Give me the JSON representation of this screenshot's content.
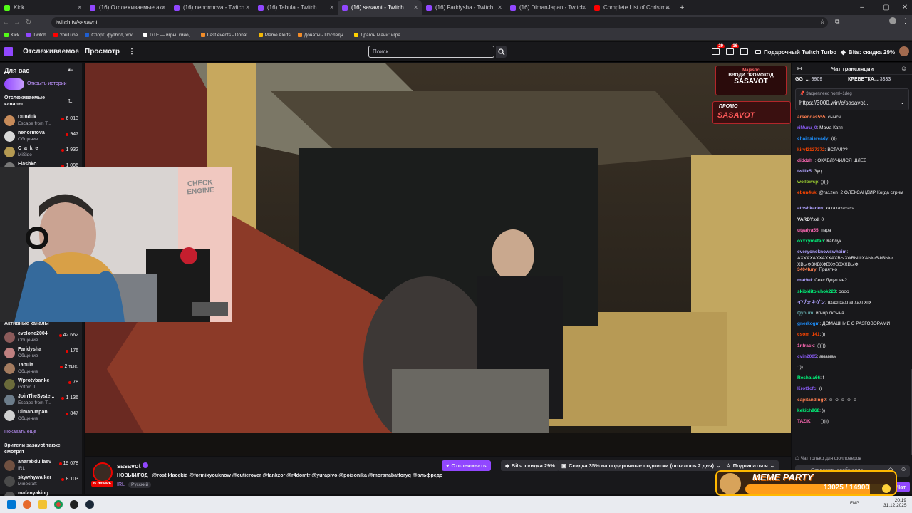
{
  "browser": {
    "tabs": [
      {
        "label": "Kick",
        "color": "#53fc18",
        "active": false
      },
      {
        "label": "(16) Отслеживаемые активные",
        "color": "#9147ff",
        "active": false
      },
      {
        "label": "(16) nenormova - Twitch",
        "color": "#9147ff",
        "active": false
      },
      {
        "label": "(16) Tabula - Twitch",
        "color": "#9147ff",
        "active": false
      },
      {
        "label": "(16) sasavot - Twitch",
        "color": "#9147ff",
        "active": true
      },
      {
        "label": "(16) Faridysha - Twitch",
        "color": "#9147ff",
        "active": false
      },
      {
        "label": "(16) DimanJapan - Twitch",
        "color": "#9147ff",
        "active": false
      },
      {
        "label": "Complete List of Christmas",
        "color": "#ff0000",
        "active": false
      }
    ],
    "url": "twitch.tv/sasavot",
    "bookmarks": [
      {
        "label": "Kick",
        "color": "#53fc18"
      },
      {
        "label": "Twitch",
        "color": "#9147ff"
      },
      {
        "label": "YouTube",
        "color": "#ff0000"
      },
      {
        "label": "Спорт: футбол, хок...",
        "color": "#1f5fd1"
      },
      {
        "label": "DTF — игры, кино,...",
        "color": "#ffffff"
      },
      {
        "label": "Last events - Donat...",
        "color": "#f28c28"
      },
      {
        "label": "Meme Alerts",
        "color": "#f2b705"
      },
      {
        "label": "Донаты - Последн...",
        "color": "#f28c28"
      },
      {
        "label": "Драгон Мани: игра...",
        "color": "#ffd200"
      }
    ]
  },
  "twitch": {
    "nav": {
      "following": "Отслеживаемое",
      "browse": "Просмотр",
      "more": "⋮"
    },
    "search_placeholder": "Поиск",
    "notif_count_1": "29",
    "notif_count_2": "16",
    "gift_turbo": "Подарочный Twitch Turbo",
    "bits_sale": "Bits: скидка 29%"
  },
  "sidebar": {
    "for_you": "Для вас",
    "open_stories": "Открыть истории",
    "followed_title": "Отслеживаемые каналы",
    "followed": [
      {
        "name": "Dunduk",
        "game": "Escape from T...",
        "viewers": "6 013",
        "color": "#c78b5a"
      },
      {
        "name": "nenormova",
        "game": "Общение",
        "viewers": "947",
        "color": "#d8d8d8"
      },
      {
        "name": "C_a_k_e",
        "game": "MiSide",
        "viewers": "1 932",
        "color": "#b59a52"
      },
      {
        "name": "Flashko",
        "game": "",
        "viewers": "1 096",
        "color": "#777"
      }
    ],
    "active_title": "Активные каналы",
    "active": [
      {
        "name": "evelone2004",
        "game": "Общение",
        "viewers": "42 662",
        "color": "#8b5a5a"
      },
      {
        "name": "Faridysha",
        "game": "Общение",
        "viewers": "176",
        "color": "#c08080"
      },
      {
        "name": "Tabula",
        "game": "Общение",
        "viewers": "2 тыс.",
        "color": "#a47b5f"
      },
      {
        "name": "Wprotvbanke",
        "game": "Gothic II",
        "viewers": "78",
        "color": "#6b6b3a"
      },
      {
        "name": "JoinTheSyste...",
        "game": "Escape from T...",
        "viewers": "1 136",
        "color": "#6c7c8a"
      },
      {
        "name": "DimanJapan",
        "game": "Общение",
        "viewers": "847",
        "color": "#d0d0d0"
      }
    ],
    "show_more": "Показать еще",
    "also_watch_title": "Зрители sasavot также смотрят",
    "also_watch": [
      {
        "name": "anarabdullaev",
        "game": "IRL",
        "viewers": "19 078",
        "color": "#705040"
      },
      {
        "name": "skywhywalker",
        "game": "Minecraft",
        "viewers": "8 103",
        "color": "#4a4a4a"
      },
      {
        "name": "mafanyaking",
        "game": "",
        "viewers": "",
        "color": "#555"
      }
    ]
  },
  "video_overlay": {
    "promo_brand": "Majestic",
    "promo_line": "ВВОДИ ПРОМОКОД",
    "promo_code": "SASAVOT",
    "promo2_top": "ПРОМО",
    "promo2_code": "SASAVOT"
  },
  "webcam": {
    "sign_line1": "CHECK",
    "sign_line2": "ENGINE"
  },
  "stream_info": {
    "channel": "sasavot",
    "title": "НОВЫЙ/ГОД | @rostikfacekid @formixyouknow @cutierover @tankzor @r4domtr @yurapivo @poisonika @moranabattoryq @альфредо",
    "live_badge": "В ЭФИРЕ",
    "category": "IRL",
    "language": "Русский",
    "follow_btn": "Отслеживать",
    "bits_btn": "Bits: скидка 29%",
    "gift_sale": "Скидка 35% на подарочные подписки (осталось 2 дня)",
    "subscribe_btn": "Подписаться"
  },
  "meme_party": {
    "title": "MEME PARTY",
    "progress_text": "13025 / 14900",
    "progress": 0.874
  },
  "chat": {
    "header": "Чат трансляции",
    "top_gifters": [
      {
        "name": "GG_...",
        "count": "6909"
      },
      {
        "name": "КРЕВЕТКА...",
        "count": "3333"
      }
    ],
    "pinned_by": "Закреплено",
    "pinned_user": "homl=1deg",
    "pinned_link": "https://3000.win/c/sasavot...",
    "messages": [
      {
        "user": "arsendas555",
        "color": "#ff7f50",
        "text": "сычсч"
      },
      {
        "user": "riMuru_0",
        "color": "#8a5cf5",
        "text": "Мама Катя"
      },
      {
        "user": "chainsisready",
        "color": "#1e90ff",
        "text": "))))"
      },
      {
        "user": "kirvl2137372",
        "color": "#ff4500",
        "text": "ВСТАЛ??"
      },
      {
        "user": "diddzh_",
        "color": "#ff69b4",
        "text": "ОКАБЛУЧИЛСЯ ШЛЕБ"
      },
      {
        "user": "twiiix5",
        "color": "#b0a3ff",
        "text": "Зуц"
      },
      {
        "user": "wollowsp",
        "color": "#9acd32",
        "text": ")))))"
      },
      {
        "user": "ebun4uk",
        "color": "#ff4500",
        "text": "@ra1zen_2 ОЛЕКСАНДИР Когда стрим"
      },
      {
        "user": "atbshkaden",
        "color": "#b0a3ff",
        "text": "хахахахахаха"
      },
      {
        "user": "VARDYxd",
        "color": "#efeff1",
        "text": "0"
      },
      {
        "user": "utyalya55",
        "color": "#ff69b4",
        "text": "пара"
      },
      {
        "user": "oxxxymetan",
        "color": "#00ff7f",
        "text": "Каблук"
      },
      {
        "user": "everyoneknowswhoim",
        "color": "#b0a3ff",
        "text": "АХХАХАХХАХХАХВЫХФВЫФХАЫФВФВЫФ ХВЫФЗХВХФВХФВЗХХВЫФ"
      },
      {
        "user": "3404fury",
        "color": "#ff7f50",
        "text": "Приятно"
      },
      {
        "user": "mat9ei",
        "color": "#b0a3ff",
        "text": "Секс будет не?"
      },
      {
        "user": "skibiditolchok220",
        "color": "#00ff7f",
        "text": "оооо"
      },
      {
        "user": "イヴォキゲン",
        "color": "#b0a3ff",
        "text": "пхахпхахпапхахпхпх"
      },
      {
        "user": "Qyoum",
        "color": "#5f9ea0",
        "text": "игнор сксыча"
      },
      {
        "user": "gnerkogm",
        "color": "#1e90ff",
        "text": "ДОМАШНИЕ С РАЗГОВОРАМИ"
      },
      {
        "user": "csom_141",
        "color": "#ff4500",
        "text": "))"
      },
      {
        "user": "1nfrack",
        "color": "#ff69b4",
        "text": "))))))"
      },
      {
        "user": "cvin2005",
        "color": "#8a5cf5",
        "text": "амамам"
      },
      {
        "user": "",
        "color": "#ff4500",
        "text": "))"
      },
      {
        "user": "Reshala66",
        "color": "#00ff7f",
        "text": "f"
      },
      {
        "user": "Krot1cfc",
        "color": "#8a5cf5",
        "text": "))"
      },
      {
        "user": "capitanding0",
        "color": "#ff7f50",
        "text": "☺ ☺ ☺ ☺ ☺"
      },
      {
        "user": "kekich968",
        "color": "#00ff7f",
        "text": "))"
      },
      {
        "user": "TAZIK___",
        "color": "#ff69b4",
        "text": ")))))"
      }
    ],
    "followers_only": "Чат только для фолловеров",
    "input_placeholder": "Отправить сообщение",
    "chat_btn": "Чат"
  },
  "taskbar": {
    "lang": "ENG",
    "time": "20:19",
    "date": "31.12.2025"
  }
}
